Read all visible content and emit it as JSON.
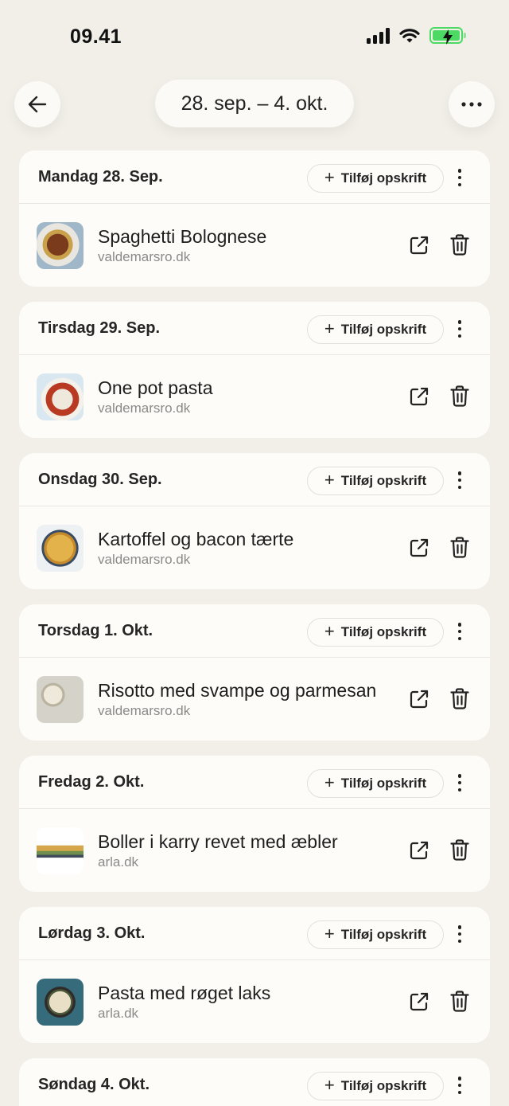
{
  "status": {
    "time": "09.41"
  },
  "nav": {
    "week_range": "28. sep. – 4. okt."
  },
  "add_label": "Tilføj opskrift",
  "days": [
    {
      "title": "Mandag 28. Sep.",
      "recipe": {
        "name": "Spaghetti Bolognese",
        "source": "valdemarsro.dk"
      }
    },
    {
      "title": "Tirsdag 29. Sep.",
      "recipe": {
        "name": "One pot pasta",
        "source": "valdemarsro.dk"
      }
    },
    {
      "title": "Onsdag 30. Sep.",
      "recipe": {
        "name": "Kartoffel og bacon tærte",
        "source": "valdemarsro.dk"
      }
    },
    {
      "title": "Torsdag 1. Okt.",
      "recipe": {
        "name": "Risotto med svampe og parmesan",
        "source": "valdemarsro.dk"
      }
    },
    {
      "title": "Fredag 2. Okt.",
      "recipe": {
        "name": "Boller i karry revet med æbler",
        "source": "arla.dk"
      }
    },
    {
      "title": "Lørdag 3. Okt.",
      "recipe": {
        "name": "Pasta med røget laks",
        "source": "arla.dk"
      }
    },
    {
      "title": "Søndag 4. Okt."
    }
  ],
  "colors": {
    "background": "#f2efe9",
    "card": "#fdfcf8",
    "battery": "#4cd964"
  }
}
